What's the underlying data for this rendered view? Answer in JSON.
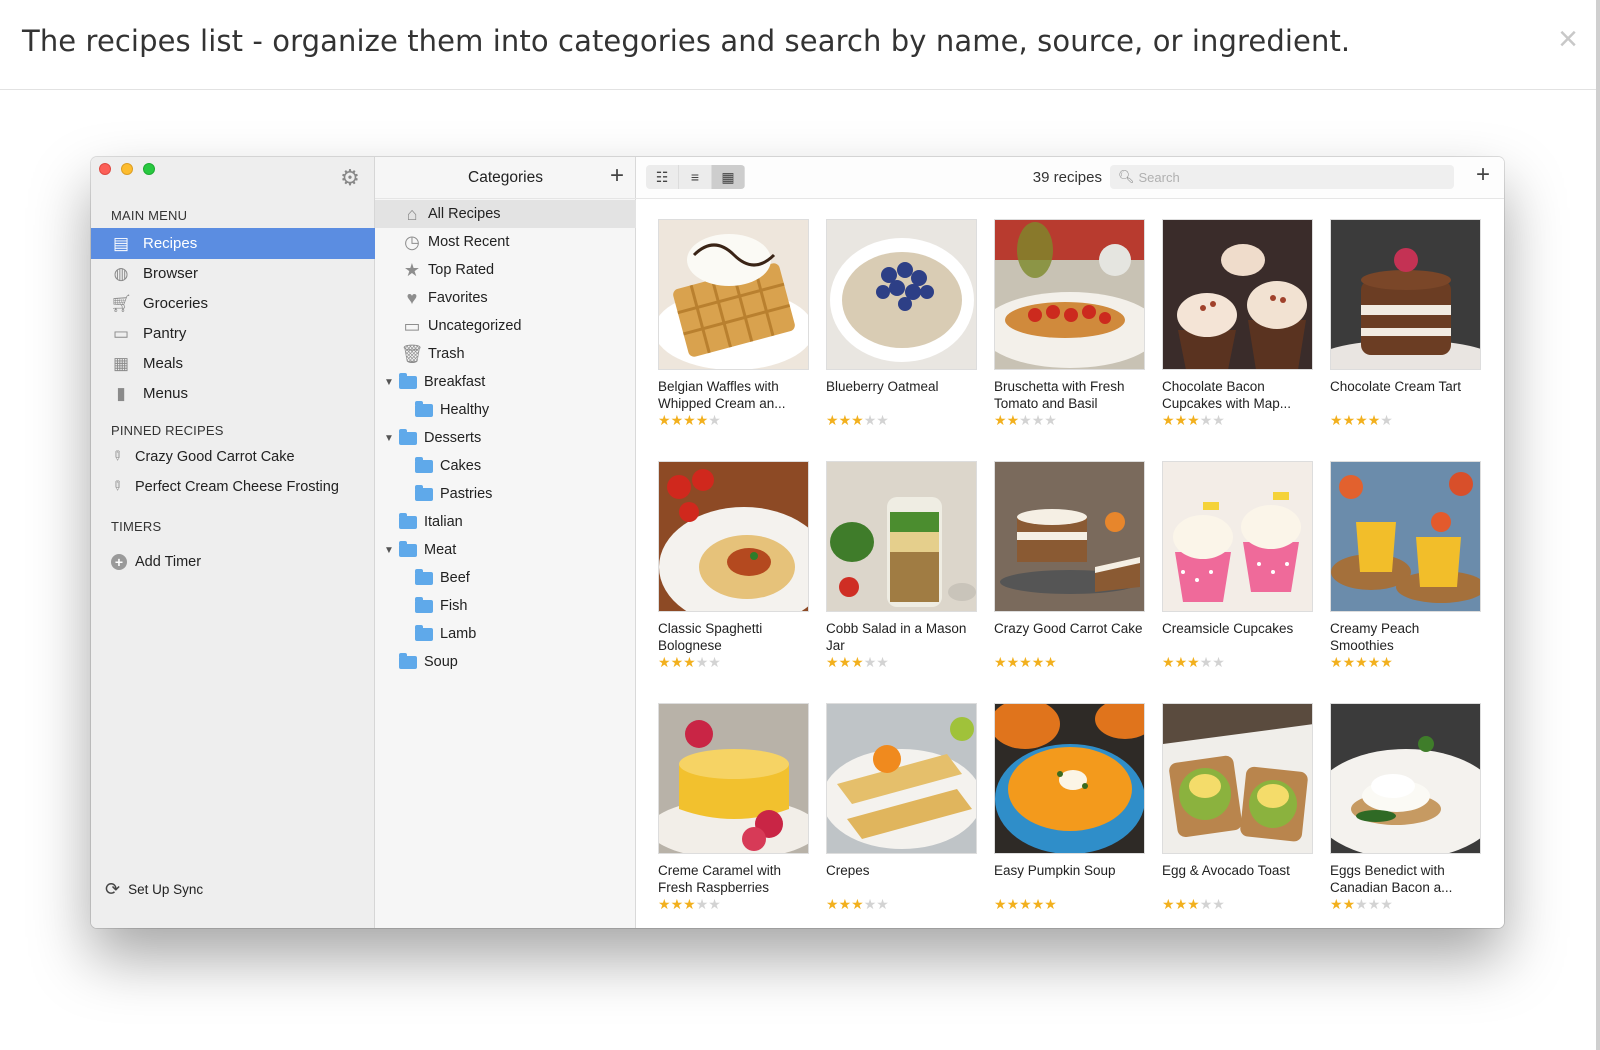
{
  "caption": "The recipes list - organize them into categories and search by name, source, or ingredient.",
  "close_glyph": "×",
  "sidebar": {
    "main_menu_title": "MAIN MENU",
    "items": [
      {
        "label": "Recipes",
        "icon": "recipes-icon",
        "active": true
      },
      {
        "label": "Browser",
        "icon": "globe-icon"
      },
      {
        "label": "Groceries",
        "icon": "cart-icon"
      },
      {
        "label": "Pantry",
        "icon": "pantry-icon"
      },
      {
        "label": "Meals",
        "icon": "calendar-icon"
      },
      {
        "label": "Menus",
        "icon": "menu-book-icon"
      }
    ],
    "pinned_title": "PINNED RECIPES",
    "pinned": [
      "Crazy Good Carrot Cake",
      "Perfect Cream Cheese Frosting"
    ],
    "timers_title": "TIMERS",
    "add_timer": "Add Timer",
    "sync_label": "Set Up Sync"
  },
  "categories": {
    "title": "Categories",
    "rows": [
      {
        "label": "All Recipes",
        "icon": "home-icon",
        "selected": true
      },
      {
        "label": "Most Recent",
        "icon": "clock-icon"
      },
      {
        "label": "Top Rated",
        "icon": "star-icon"
      },
      {
        "label": "Favorites",
        "icon": "heart-icon"
      },
      {
        "label": "Uncategorized",
        "icon": "tray-icon"
      },
      {
        "label": "Trash",
        "icon": "trash-icon"
      },
      {
        "label": "Breakfast",
        "icon": "folder-icon",
        "expanded": true
      },
      {
        "label": "Healthy",
        "icon": "folder-icon",
        "child": true
      },
      {
        "label": "Desserts",
        "icon": "folder-icon",
        "expanded": true
      },
      {
        "label": "Cakes",
        "icon": "folder-icon",
        "child": true
      },
      {
        "label": "Pastries",
        "icon": "folder-icon",
        "child": true
      },
      {
        "label": "Italian",
        "icon": "folder-icon"
      },
      {
        "label": "Meat",
        "icon": "folder-icon",
        "expanded": true
      },
      {
        "label": "Beef",
        "icon": "folder-icon",
        "child": true
      },
      {
        "label": "Fish",
        "icon": "folder-icon",
        "child": true
      },
      {
        "label": "Lamb",
        "icon": "folder-icon",
        "child": true
      },
      {
        "label": "Soup",
        "icon": "folder-icon"
      }
    ]
  },
  "toolbar": {
    "recipe_count": "39 recipes",
    "search_placeholder": "Search"
  },
  "recipes": [
    {
      "title": "Belgian Waffles with Whipped Cream an...",
      "rating": 4,
      "photo": "waffles"
    },
    {
      "title": "Blueberry Oatmeal",
      "rating": 3,
      "photo": "oatmeal"
    },
    {
      "title": "Bruschetta with Fresh Tomato and Basil",
      "rating": 2,
      "photo": "bruschetta"
    },
    {
      "title": "Chocolate Bacon Cupcakes with Map...",
      "rating": 3,
      "photo": "cupcakes"
    },
    {
      "title": "Chocolate Cream Tart",
      "rating": 4,
      "photo": "tart"
    },
    {
      "title": "Classic Spaghetti Bolognese",
      "rating": 3,
      "photo": "spaghetti"
    },
    {
      "title": "Cobb Salad in a Mason Jar",
      "rating": 3,
      "photo": "salad"
    },
    {
      "title": "Crazy Good Carrot Cake",
      "rating": 5,
      "photo": "carrot-cake"
    },
    {
      "title": "Creamsicle Cupcakes",
      "rating": 3,
      "photo": "creamsicle"
    },
    {
      "title": "Creamy Peach Smoothies",
      "rating": 5,
      "photo": "smoothie"
    },
    {
      "title": "Creme Caramel with Fresh Raspberries",
      "rating": 3,
      "photo": "caramel"
    },
    {
      "title": "Crepes",
      "rating": 3,
      "photo": "crepes"
    },
    {
      "title": "Easy Pumpkin Soup",
      "rating": 5,
      "photo": "pumpkin-soup"
    },
    {
      "title": "Egg & Avocado Toast",
      "rating": 3,
      "photo": "avocado-toast"
    },
    {
      "title": "Eggs Benedict with Canadian Bacon a...",
      "rating": 2,
      "photo": "eggs-benedict"
    }
  ],
  "colors": {
    "accent": "#5b8de1",
    "star": "#f2b01e",
    "folder": "#5fa9ea"
  }
}
